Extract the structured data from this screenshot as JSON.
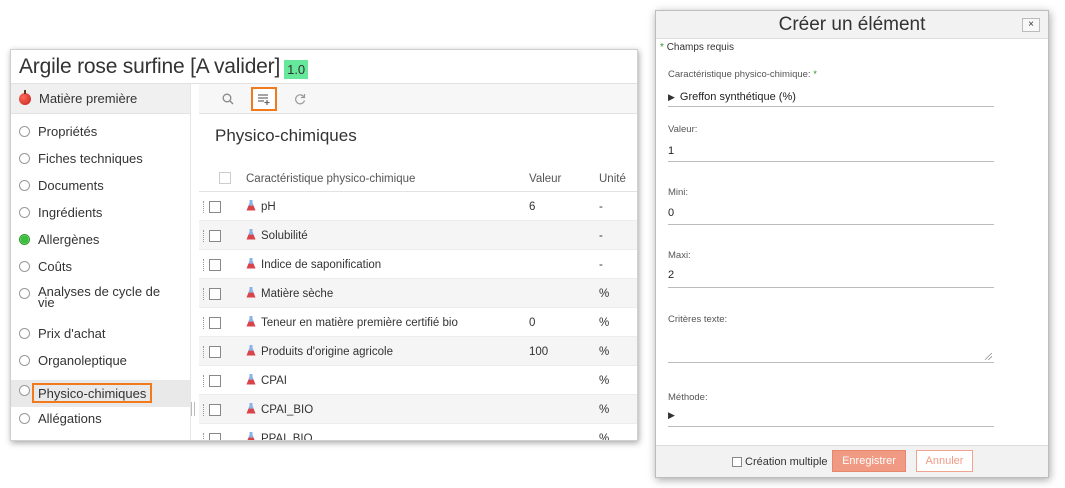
{
  "left_window": {
    "title": "Argile rose surfine [A valider]",
    "version": "1.0",
    "sidebar": {
      "header": "Matière première",
      "items": [
        {
          "label": "Propriétés",
          "selected": false
        },
        {
          "label": "Fiches techniques",
          "selected": false
        },
        {
          "label": "Documents",
          "selected": false
        },
        {
          "label": "Ingrédients",
          "selected": false
        },
        {
          "label": "Allergènes",
          "selected": true
        },
        {
          "label": "Coûts",
          "selected": false
        },
        {
          "label": "Analyses de cycle de vie",
          "selected": false
        },
        {
          "label": "Prix d'achat",
          "selected": false
        },
        {
          "label": "Organoleptique",
          "selected": false
        },
        {
          "label": "Physico-chimiques",
          "selected": false,
          "active": true
        },
        {
          "label": "Allégations",
          "selected": false
        }
      ]
    },
    "toolbar": {
      "icons": [
        "search-icon",
        "add-list-icon",
        "refresh-icon"
      ]
    },
    "section_title": "Physico-chimiques",
    "table": {
      "columns": [
        "Caractéristique physico-chimique",
        "Valeur",
        "Unité"
      ],
      "rows": [
        {
          "name": "pH",
          "value": "6",
          "unit": "-"
        },
        {
          "name": "Solubilité",
          "value": "",
          "unit": "-"
        },
        {
          "name": "Indice de saponification",
          "value": "",
          "unit": "-"
        },
        {
          "name": "Matière sèche",
          "value": "",
          "unit": "%"
        },
        {
          "name": "Teneur en matière première certifié bio",
          "value": "0",
          "unit": "%"
        },
        {
          "name": "Produits d'origine agricole",
          "value": "100",
          "unit": "%"
        },
        {
          "name": "CPAI",
          "value": "",
          "unit": "%"
        },
        {
          "name": "CPAI_BIO",
          "value": "",
          "unit": "%"
        },
        {
          "name": "PPAI_BIO",
          "value": "",
          "unit": "%"
        }
      ]
    }
  },
  "dialog": {
    "title": "Créer un élément",
    "close_label": "×",
    "required_note": "Champs requis",
    "fields": {
      "characteristic_label": "Caractéristique physico-chimique:",
      "characteristic_value": "Greffon synthétique (%)",
      "value_label": "Valeur:",
      "value_value": "1",
      "mini_label": "Mini:",
      "mini_value": "0",
      "maxi_label": "Maxi:",
      "maxi_value": "2",
      "criteria_label": "Critères texte:",
      "method_label": "Méthode:"
    },
    "footer": {
      "multiple_label": "Création multiple",
      "save_label": "Enregistrer",
      "cancel_label": "Annuler"
    }
  },
  "colors": {
    "accent_orange": "#f07a1c",
    "version_badge": "#66e89a",
    "save_button": "#f09a83",
    "selected_radio": "#3cbf3c",
    "flask": "#d9434a"
  }
}
